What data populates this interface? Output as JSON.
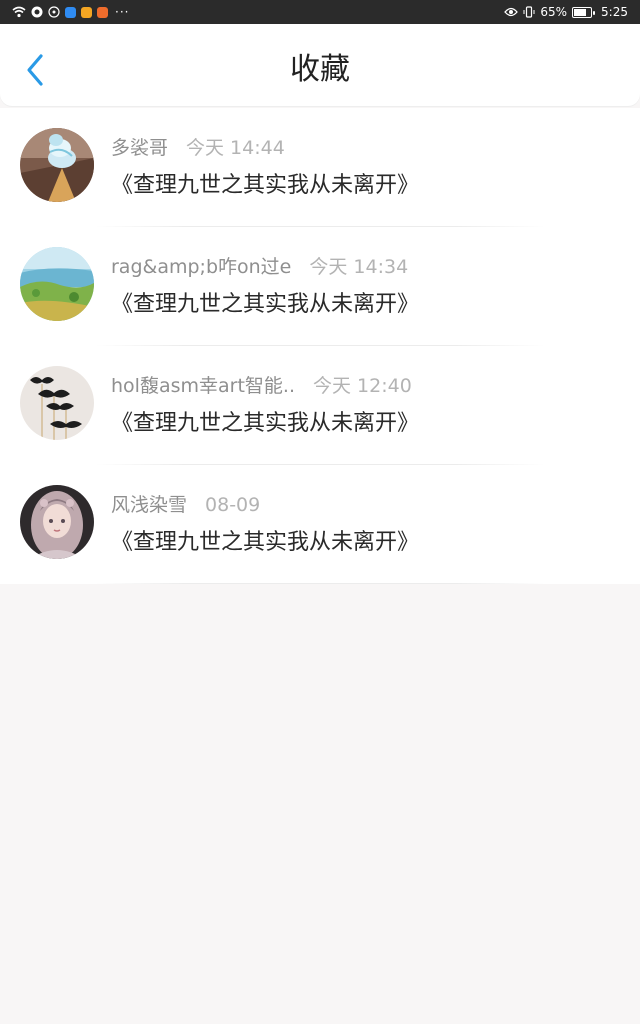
{
  "status_bar": {
    "battery_percent": "65%",
    "time": "5:25",
    "more": "···",
    "notification_icons": [
      {
        "name": "wifi-icon"
      },
      {
        "name": "app-icon-1",
        "color": "#ffffff"
      },
      {
        "name": "app-icon-2",
        "color": "#ffffff"
      },
      {
        "name": "app-icon-3",
        "color": "#2f8cf3"
      },
      {
        "name": "app-icon-4",
        "color": "#f4a623"
      },
      {
        "name": "app-icon-5",
        "color": "#ef6c2c"
      }
    ]
  },
  "header": {
    "title": "收藏",
    "back_icon": "chevron-left-icon",
    "accent_color": "#2a9ae6"
  },
  "favorites": [
    {
      "name": "多裟哥",
      "time": "今天 14:44",
      "book": "《查理九世之其实我从未离开》",
      "avatar": "ice-cream-avatar"
    },
    {
      "name": "rag&amp;b咋on过e",
      "time": "今天 14:34",
      "book": "《查理九世之其实我从未离开》",
      "avatar": "landscape-avatar"
    },
    {
      "name": "hol馥asm幸art智能..",
      "time": "今天 12:40",
      "book": "《查理九世之其实我从未离开》",
      "avatar": "mustache-avatar"
    },
    {
      "name": "风浅染雪",
      "time": "08-09",
      "book": "《查理九世之其实我从未离开》",
      "avatar": "anime-girl-avatar"
    }
  ]
}
